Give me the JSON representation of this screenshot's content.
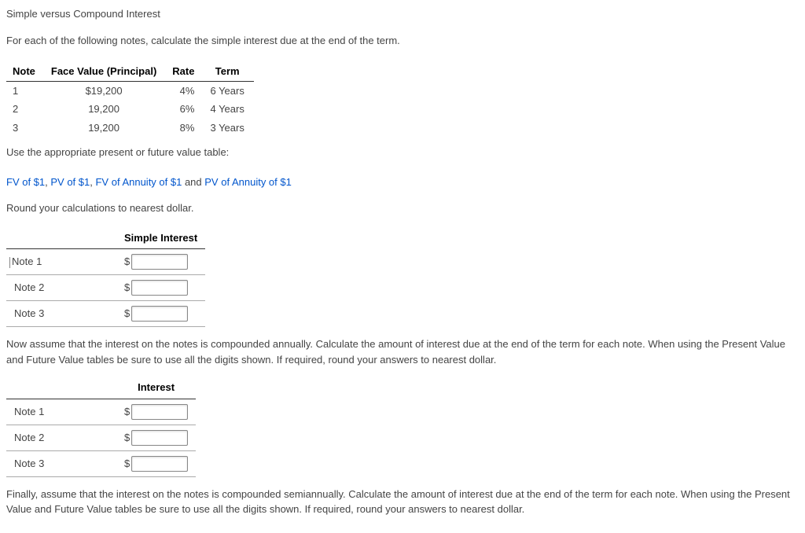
{
  "title": "Simple versus Compound Interest",
  "intro": "For each of the following notes, calculate the simple interest due at the end of the term.",
  "notes_table": {
    "headers": {
      "note": "Note",
      "face": "Face Value (Principal)",
      "rate": "Rate",
      "term": "Term"
    },
    "rows": [
      {
        "note": "1",
        "face": "$19,200",
        "rate": "4%",
        "term": "6 Years"
      },
      {
        "note": "2",
        "face": "19,200",
        "rate": "6%",
        "term": "4 Years"
      },
      {
        "note": "3",
        "face": "19,200",
        "rate": "8%",
        "term": "3 Years"
      }
    ]
  },
  "link_pre": "Use the appropriate present or future value table:",
  "links": {
    "fv1": "FV of $1",
    "pv1": "PV of $1",
    "fva1": "FV of Annuity of $1",
    "pva1": "PV of Annuity of $1",
    "sep_comma": ", ",
    "sep_and": " and "
  },
  "round_note": "Round your calculations to nearest dollar.",
  "simple_section": {
    "header": "Simple Interest",
    "rows": [
      {
        "label": "Note 1",
        "value": ""
      },
      {
        "label": "Note 2",
        "value": ""
      },
      {
        "label": "Note 3",
        "value": ""
      }
    ]
  },
  "compound_annual_para": "Now assume that the interest on the notes is compounded annually. Calculate the amount of interest due at the end of the term for each note. When using the Present Value and Future Value tables be sure to use all the digits shown. If required, round your answers to nearest dollar.",
  "interest_section": {
    "header": "Interest",
    "rows": [
      {
        "label": "Note 1",
        "value": ""
      },
      {
        "label": "Note 2",
        "value": ""
      },
      {
        "label": "Note 3",
        "value": ""
      }
    ]
  },
  "compound_semi_para": "Finally, assume that the interest on the notes is compounded semiannually. Calculate the amount of interest due at the end of the term for each note. When using the Present Value and Future Value tables be sure to use all the digits shown. If required, round your answers to nearest dollar.",
  "currency": "$"
}
